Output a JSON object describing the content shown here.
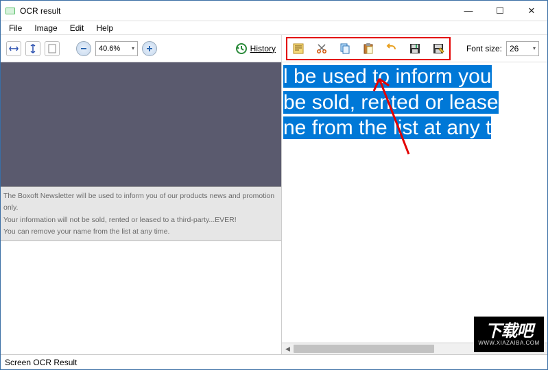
{
  "window": {
    "title": "OCR result",
    "controls": {
      "min": "—",
      "max": "☐",
      "close": "✕"
    }
  },
  "menu": {
    "file": "File",
    "image": "Image",
    "edit": "Edit",
    "help": "Help"
  },
  "left_toolbar": {
    "zoom_value": "40.6%",
    "history_label": "History"
  },
  "right_toolbar": {
    "font_size_label": "Font size:",
    "font_size_value": "26"
  },
  "source_lines": [
    "The Boxoft Newsletter will be used to inform you of our products news and promotion only.",
    "Your information will not be sold, rented or leased to a third-party...EVER!",
    "You can remove your name from the list at any time."
  ],
  "result_text": "l be used to inform you\nbe sold, rented or lease\nne from the list at any t",
  "statusbar": {
    "text": "Screen OCR Result"
  },
  "watermark": {
    "big": "下载吧",
    "small": "WWW.XIAZAIBA.COM"
  }
}
